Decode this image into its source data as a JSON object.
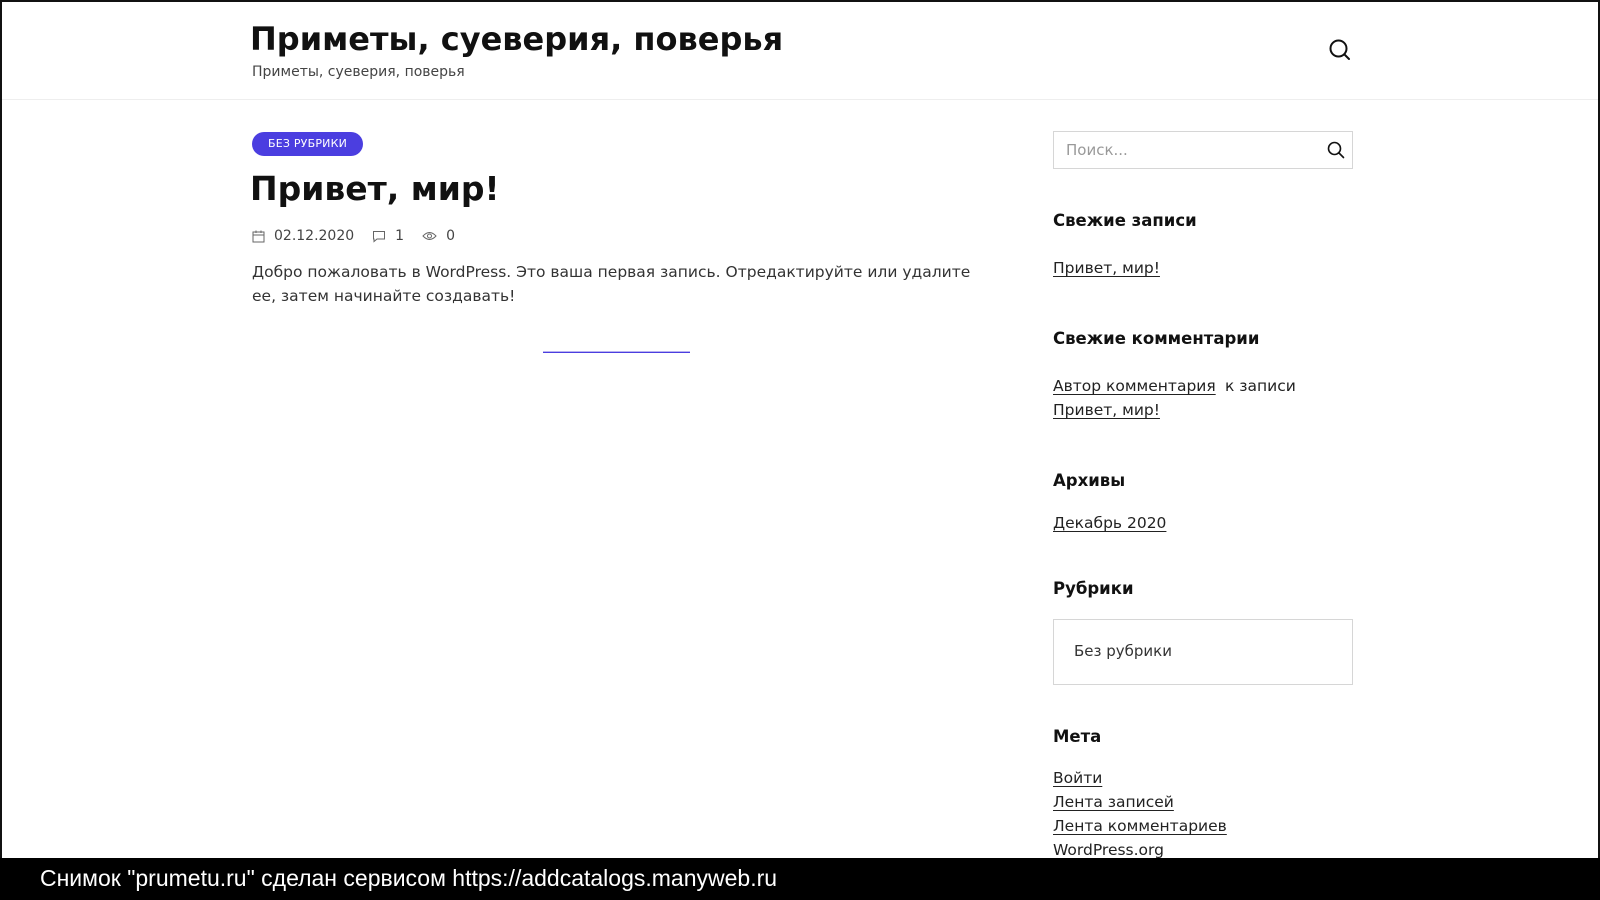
{
  "header": {
    "site_title": "Приметы, суеверия, поверья",
    "site_description": "Приметы, суеверия, поверья",
    "search_icon": "search-icon"
  },
  "post": {
    "category": "БЕЗ РУБРИКИ",
    "title": "Привет, мир!",
    "date": "02.12.2020",
    "comments_count": "1",
    "views_count": "0",
    "excerpt": "Добро пожаловать в WordPress. Это ваша первая запись. Отредактируйте или удалите ее, затем начинайте создавать!"
  },
  "sidebar": {
    "search": {
      "placeholder": "Поиск..."
    },
    "recent_posts": {
      "title": "Свежие записи",
      "items": [
        "Привет, мир!"
      ]
    },
    "recent_comments": {
      "title": "Свежие комментарии",
      "author": "Автор комментария",
      "connector": "к записи",
      "post": "Привет, мир!"
    },
    "archives": {
      "title": "Архивы",
      "items": [
        "Декабрь 2020"
      ]
    },
    "categories": {
      "title": "Рубрики",
      "items": [
        "Без рубрики"
      ]
    },
    "meta": {
      "title": "Мета",
      "items": [
        "Войти",
        "Лента записей",
        "Лента комментариев",
        "WordPress.org"
      ]
    }
  },
  "footer_bar": {
    "text": "Снимок \"prumetu.ru\" сделан сервисом https://addcatalogs.manyweb.ru"
  },
  "colors": {
    "accent": "#4b3ee0",
    "text": "#222222",
    "footer_bg": "#000000"
  }
}
